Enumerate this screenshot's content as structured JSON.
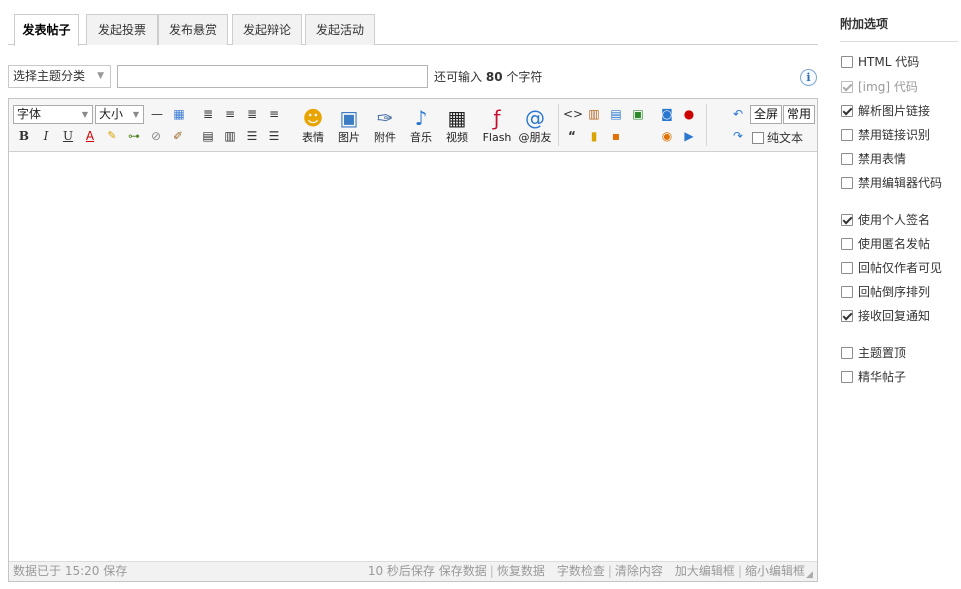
{
  "tabs": [
    {
      "label": "发表帖子",
      "active": true
    },
    {
      "label": "发起投票",
      "active": false
    },
    {
      "label": "发布悬赏",
      "active": false
    },
    {
      "label": "发起辩论",
      "active": false
    },
    {
      "label": "发起活动",
      "active": false
    }
  ],
  "subject": {
    "type_select": "选择主题分类",
    "title_value": "",
    "remain_prefix": "还可输入",
    "remain_count": "80",
    "remain_suffix": "个字符"
  },
  "toolbar": {
    "font_select": "字体",
    "size_select": "大小",
    "insert_labels": {
      "emoticon": "表情",
      "image": "图片",
      "attach": "附件",
      "music": "音乐",
      "video": "视频",
      "flash": "Flash",
      "at_friend": "@朋友"
    },
    "fullscreen": "全屏",
    "common": "常用",
    "plain_text": "纯文本"
  },
  "statusbar": {
    "saved_info": "数据已于 15:20 保存",
    "autosave": "10 秒后保存",
    "save_data": "保存数据",
    "restore_data": "恢复数据",
    "word_check": "字数检查",
    "clear_content": "清除内容",
    "enlarge": "加大编辑框",
    "shrink": "缩小编辑框"
  },
  "options": {
    "title": "附加选项",
    "items": [
      {
        "label": "HTML 代码",
        "checked": false,
        "disabled": false
      },
      {
        "label": "[img] 代码",
        "checked": true,
        "disabled": true
      },
      {
        "label": "解析图片链接",
        "checked": true,
        "disabled": false
      },
      {
        "label": "禁用链接识别",
        "checked": false,
        "disabled": false
      },
      {
        "label": "禁用表情",
        "checked": false,
        "disabled": false
      },
      {
        "label": "禁用编辑器代码",
        "checked": false,
        "disabled": false
      },
      {
        "label": "使用个人签名",
        "checked": true,
        "disabled": false
      },
      {
        "label": "使用匿名发帖",
        "checked": false,
        "disabled": false
      },
      {
        "label": "回帖仅作者可见",
        "checked": false,
        "disabled": false
      },
      {
        "label": "回帖倒序排列",
        "checked": false,
        "disabled": false
      },
      {
        "label": "接收回复通知",
        "checked": true,
        "disabled": false
      },
      {
        "label": "主题置顶",
        "checked": false,
        "disabled": false
      },
      {
        "label": "精华帖子",
        "checked": false,
        "disabled": false
      }
    ]
  }
}
